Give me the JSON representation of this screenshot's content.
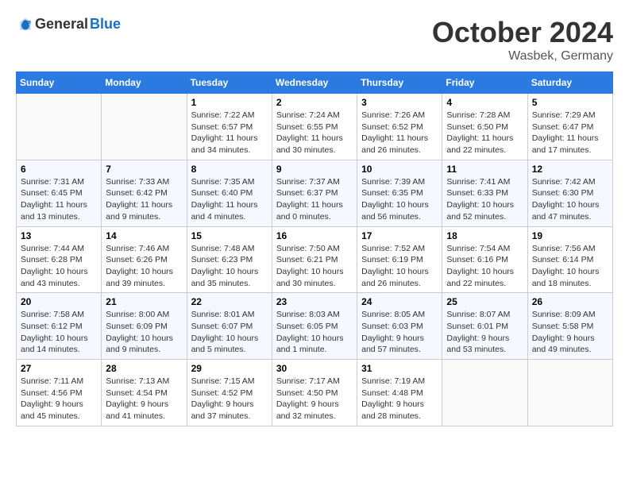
{
  "logo": {
    "general": "General",
    "blue": "Blue"
  },
  "header": {
    "month": "October 2024",
    "location": "Wasbek, Germany"
  },
  "weekdays": [
    "Sunday",
    "Monday",
    "Tuesday",
    "Wednesday",
    "Thursday",
    "Friday",
    "Saturday"
  ],
  "weeks": [
    [
      {
        "day": "",
        "info": ""
      },
      {
        "day": "",
        "info": ""
      },
      {
        "day": "1",
        "info": "Sunrise: 7:22 AM\nSunset: 6:57 PM\nDaylight: 11 hours\nand 34 minutes."
      },
      {
        "day": "2",
        "info": "Sunrise: 7:24 AM\nSunset: 6:55 PM\nDaylight: 11 hours\nand 30 minutes."
      },
      {
        "day": "3",
        "info": "Sunrise: 7:26 AM\nSunset: 6:52 PM\nDaylight: 11 hours\nand 26 minutes."
      },
      {
        "day": "4",
        "info": "Sunrise: 7:28 AM\nSunset: 6:50 PM\nDaylight: 11 hours\nand 22 minutes."
      },
      {
        "day": "5",
        "info": "Sunrise: 7:29 AM\nSunset: 6:47 PM\nDaylight: 11 hours\nand 17 minutes."
      }
    ],
    [
      {
        "day": "6",
        "info": "Sunrise: 7:31 AM\nSunset: 6:45 PM\nDaylight: 11 hours\nand 13 minutes."
      },
      {
        "day": "7",
        "info": "Sunrise: 7:33 AM\nSunset: 6:42 PM\nDaylight: 11 hours\nand 9 minutes."
      },
      {
        "day": "8",
        "info": "Sunrise: 7:35 AM\nSunset: 6:40 PM\nDaylight: 11 hours\nand 4 minutes."
      },
      {
        "day": "9",
        "info": "Sunrise: 7:37 AM\nSunset: 6:37 PM\nDaylight: 11 hours\nand 0 minutes."
      },
      {
        "day": "10",
        "info": "Sunrise: 7:39 AM\nSunset: 6:35 PM\nDaylight: 10 hours\nand 56 minutes."
      },
      {
        "day": "11",
        "info": "Sunrise: 7:41 AM\nSunset: 6:33 PM\nDaylight: 10 hours\nand 52 minutes."
      },
      {
        "day": "12",
        "info": "Sunrise: 7:42 AM\nSunset: 6:30 PM\nDaylight: 10 hours\nand 47 minutes."
      }
    ],
    [
      {
        "day": "13",
        "info": "Sunrise: 7:44 AM\nSunset: 6:28 PM\nDaylight: 10 hours\nand 43 minutes."
      },
      {
        "day": "14",
        "info": "Sunrise: 7:46 AM\nSunset: 6:26 PM\nDaylight: 10 hours\nand 39 minutes."
      },
      {
        "day": "15",
        "info": "Sunrise: 7:48 AM\nSunset: 6:23 PM\nDaylight: 10 hours\nand 35 minutes."
      },
      {
        "day": "16",
        "info": "Sunrise: 7:50 AM\nSunset: 6:21 PM\nDaylight: 10 hours\nand 30 minutes."
      },
      {
        "day": "17",
        "info": "Sunrise: 7:52 AM\nSunset: 6:19 PM\nDaylight: 10 hours\nand 26 minutes."
      },
      {
        "day": "18",
        "info": "Sunrise: 7:54 AM\nSunset: 6:16 PM\nDaylight: 10 hours\nand 22 minutes."
      },
      {
        "day": "19",
        "info": "Sunrise: 7:56 AM\nSunset: 6:14 PM\nDaylight: 10 hours\nand 18 minutes."
      }
    ],
    [
      {
        "day": "20",
        "info": "Sunrise: 7:58 AM\nSunset: 6:12 PM\nDaylight: 10 hours\nand 14 minutes."
      },
      {
        "day": "21",
        "info": "Sunrise: 8:00 AM\nSunset: 6:09 PM\nDaylight: 10 hours\nand 9 minutes."
      },
      {
        "day": "22",
        "info": "Sunrise: 8:01 AM\nSunset: 6:07 PM\nDaylight: 10 hours\nand 5 minutes."
      },
      {
        "day": "23",
        "info": "Sunrise: 8:03 AM\nSunset: 6:05 PM\nDaylight: 10 hours\nand 1 minute."
      },
      {
        "day": "24",
        "info": "Sunrise: 8:05 AM\nSunset: 6:03 PM\nDaylight: 9 hours\nand 57 minutes."
      },
      {
        "day": "25",
        "info": "Sunrise: 8:07 AM\nSunset: 6:01 PM\nDaylight: 9 hours\nand 53 minutes."
      },
      {
        "day": "26",
        "info": "Sunrise: 8:09 AM\nSunset: 5:58 PM\nDaylight: 9 hours\nand 49 minutes."
      }
    ],
    [
      {
        "day": "27",
        "info": "Sunrise: 7:11 AM\nSunset: 4:56 PM\nDaylight: 9 hours\nand 45 minutes."
      },
      {
        "day": "28",
        "info": "Sunrise: 7:13 AM\nSunset: 4:54 PM\nDaylight: 9 hours\nand 41 minutes."
      },
      {
        "day": "29",
        "info": "Sunrise: 7:15 AM\nSunset: 4:52 PM\nDaylight: 9 hours\nand 37 minutes."
      },
      {
        "day": "30",
        "info": "Sunrise: 7:17 AM\nSunset: 4:50 PM\nDaylight: 9 hours\nand 32 minutes."
      },
      {
        "day": "31",
        "info": "Sunrise: 7:19 AM\nSunset: 4:48 PM\nDaylight: 9 hours\nand 28 minutes."
      },
      {
        "day": "",
        "info": ""
      },
      {
        "day": "",
        "info": ""
      }
    ]
  ]
}
